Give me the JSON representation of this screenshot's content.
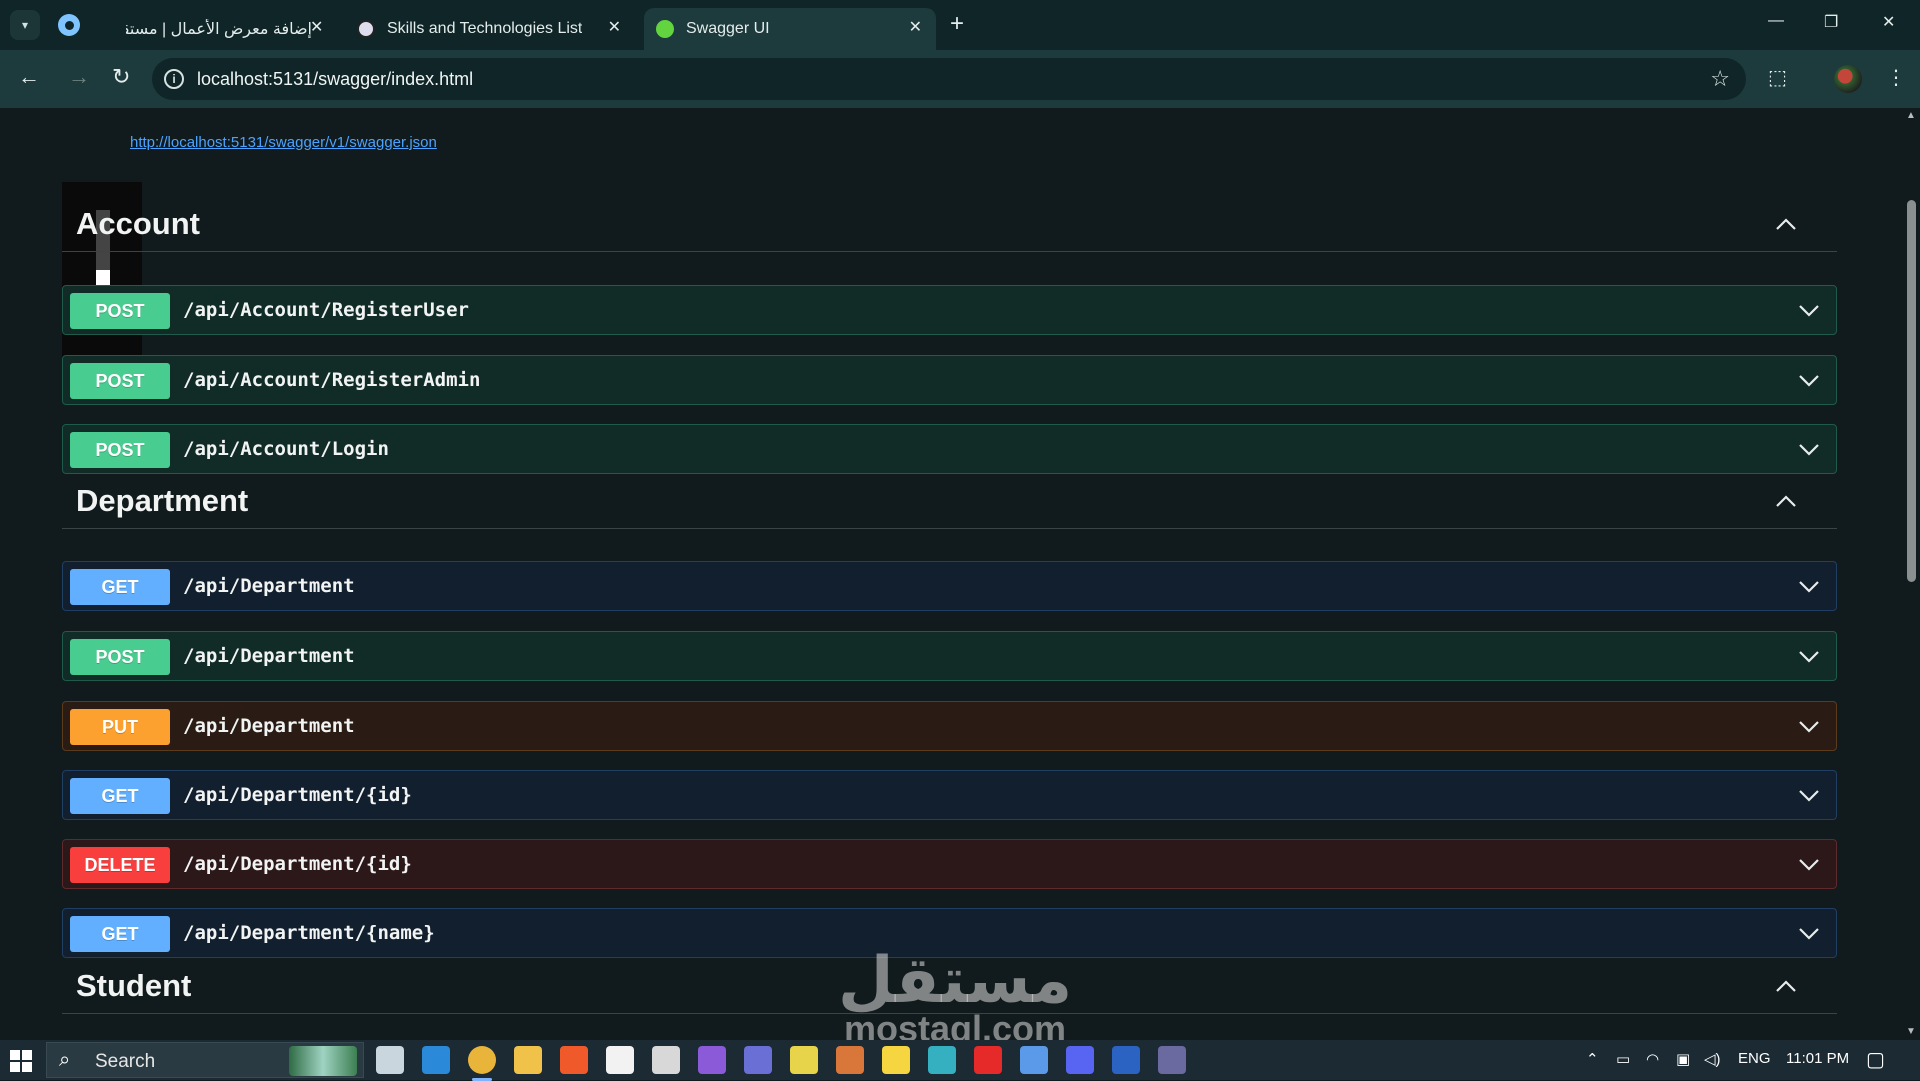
{
  "browser": {
    "tabs": [
      {
        "title": "إضافة معرض الأعمال | مستقل"
      },
      {
        "title": "Skills and Technologies List"
      },
      {
        "title": "Swagger UI"
      }
    ],
    "new_tab_glyph": "+",
    "close_glyph": "✕",
    "window_controls": {
      "minimize": "—",
      "restore": "❐",
      "close": "✕"
    },
    "address": "localhost:5131/swagger/index.html",
    "nav": {
      "back": "←",
      "forward": "→",
      "reload": "↻"
    },
    "info_glyph": "i",
    "bookmark_glyph": "☆",
    "extensions_glyph": "⬚",
    "menu_glyph": "⋮"
  },
  "swagger": {
    "spec_url": "http://localhost:5131/swagger/v1/swagger.json",
    "sections": [
      {
        "name": "Account",
        "operations": [
          {
            "method": "POST",
            "path": "/api/Account/RegisterUser"
          },
          {
            "method": "POST",
            "path": "/api/Account/RegisterAdmin"
          },
          {
            "method": "POST",
            "path": "/api/Account/Login"
          }
        ]
      },
      {
        "name": "Department",
        "operations": [
          {
            "method": "GET",
            "path": "/api/Department"
          },
          {
            "method": "POST",
            "path": "/api/Department"
          },
          {
            "method": "PUT",
            "path": "/api/Department"
          },
          {
            "method": "GET",
            "path": "/api/Department/{id}"
          },
          {
            "method": "DELETE",
            "path": "/api/Department/{id}"
          },
          {
            "method": "GET",
            "path": "/api/Department/{name}"
          }
        ]
      },
      {
        "name": "Student",
        "operations": []
      }
    ],
    "method_colors": {
      "POST": "#49cc90",
      "GET": "#61affe",
      "PUT": "#fca130",
      "DELETE": "#f93e3e"
    }
  },
  "watermark": {
    "arabic": "مستقل",
    "latin": "mostaql.com"
  },
  "taskbar": {
    "search_placeholder": "Search",
    "search_glyph": "⌕",
    "language": "ENG",
    "time": "11:01 PM",
    "apps": [
      "task-view",
      "vscode",
      "chrome",
      "file-explorer",
      "brave",
      "notion",
      "unity",
      "visual-studio",
      "teams",
      "sticky-app",
      "claude",
      "sticky-notes",
      "edge",
      "youtube",
      "copilot",
      "discord",
      "word",
      "terminal"
    ]
  }
}
